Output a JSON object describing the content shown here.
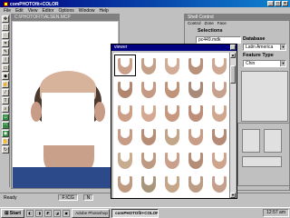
{
  "app": {
    "title": "comPHOTOfit+COLOR",
    "menu": [
      "File",
      "Edit",
      "View",
      "Editor",
      "Options",
      "Window",
      "Help"
    ]
  },
  "document": {
    "title": "C:\\PHOTOFIT\\ALSEN.MCP"
  },
  "panel": {
    "title": "Shell Control",
    "menu": [
      "Control",
      "Zone",
      "Face"
    ],
    "selections_label": "Selections",
    "selection_value": "pc449.mdk",
    "database_label": "Database",
    "database_value": "Latin America",
    "feature_type_label": "Feature Type",
    "feature_type_value": "Chin",
    "gray_check_label": "Gray Check"
  },
  "viewer": {
    "title": "viewer",
    "thumb_colors": [
      "#c9a08a",
      "#c4a089",
      "#d2ac94",
      "#b8917a",
      "#cfa891",
      "#b0866f",
      "#c49a84",
      "#c09479",
      "#a98a78",
      "#c6a28e",
      "#cd9e86",
      "#d5a892",
      "#c7977f",
      "#bd8e78",
      "#d1a68f",
      "#c79c86",
      "#b88d75",
      "#c2a68a",
      "#c89e87",
      "#b58a76",
      "#c8ac90",
      "#bf9a82",
      "#caa08b",
      "#b48d77",
      "#cfa48c",
      "#c09a80",
      "#a8967c",
      "#c6a688",
      "#bc9c84",
      "#c4a08c"
    ]
  },
  "status": {
    "ready": "Ready",
    "field1": "F:\\CG",
    "field2": "N"
  },
  "taskbar": {
    "start": "Start",
    "tasks": [
      "Adobe Photoshop",
      "comPHOTOfit+COLOR"
    ],
    "active_index": 1,
    "clock": "12:57 am"
  }
}
